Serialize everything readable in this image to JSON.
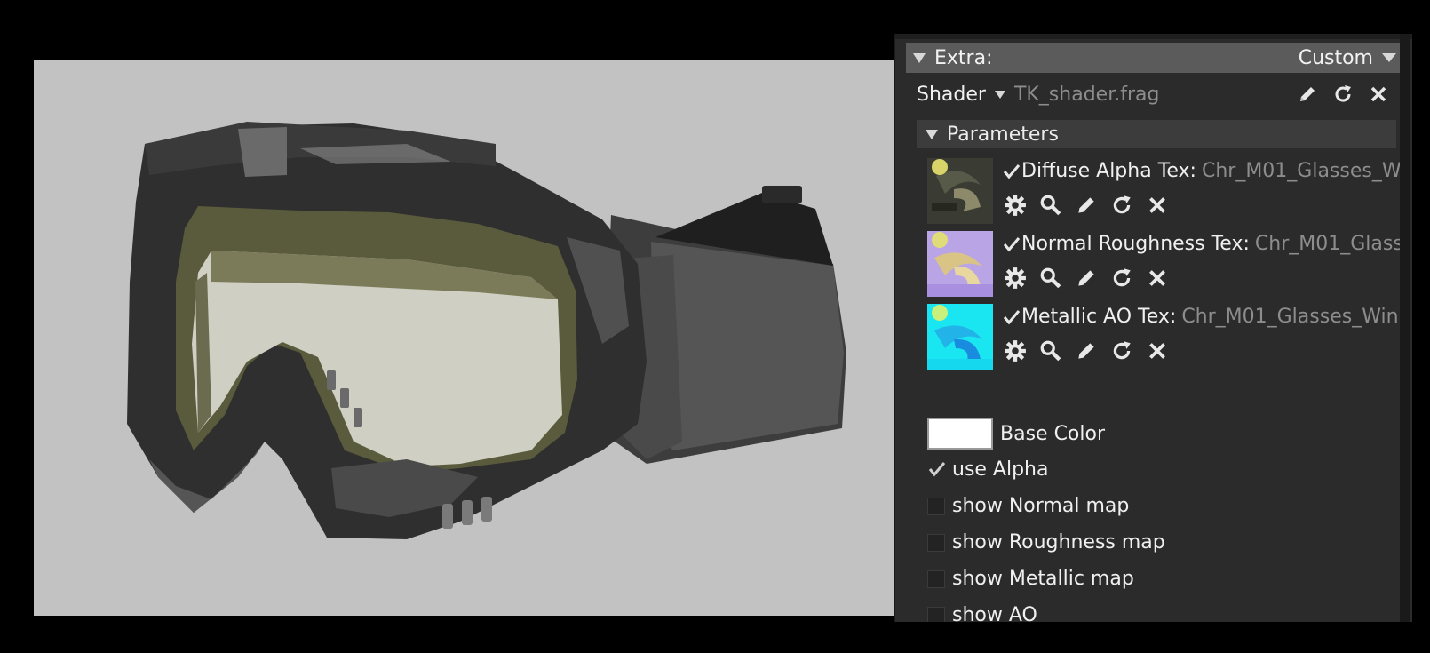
{
  "extra": {
    "label": "Extra:",
    "value": "Custom"
  },
  "shader": {
    "label": "Shader",
    "file": "TK_shader.frag"
  },
  "parameters": {
    "label": "Parameters",
    "textures": [
      {
        "name": "Diffuse Alpha Tex:",
        "file": "Chr_M01_Glasses_W",
        "checked": true
      },
      {
        "name": "Normal Roughness Tex:",
        "file": "Chr_M01_Glass",
        "checked": true
      },
      {
        "name": "Metallic AO Tex:",
        "file": "Chr_M01_Glasses_Win",
        "checked": true
      }
    ],
    "base_color": {
      "label": "Base Color",
      "value": "#ffffff"
    },
    "checkboxes": [
      {
        "label": "use Alpha",
        "checked": true
      },
      {
        "label": "show Normal map",
        "checked": false
      },
      {
        "label": "show Roughness map",
        "checked": false
      },
      {
        "label": "show Metallic map",
        "checked": false
      },
      {
        "label": "show AO",
        "checked": false
      }
    ]
  },
  "colors": {
    "viewport_bg": "#c2c2c2",
    "panel_bg": "#2b2b2b",
    "header_bg": "#5b5b5b",
    "muted_text": "#8d8d8d"
  }
}
